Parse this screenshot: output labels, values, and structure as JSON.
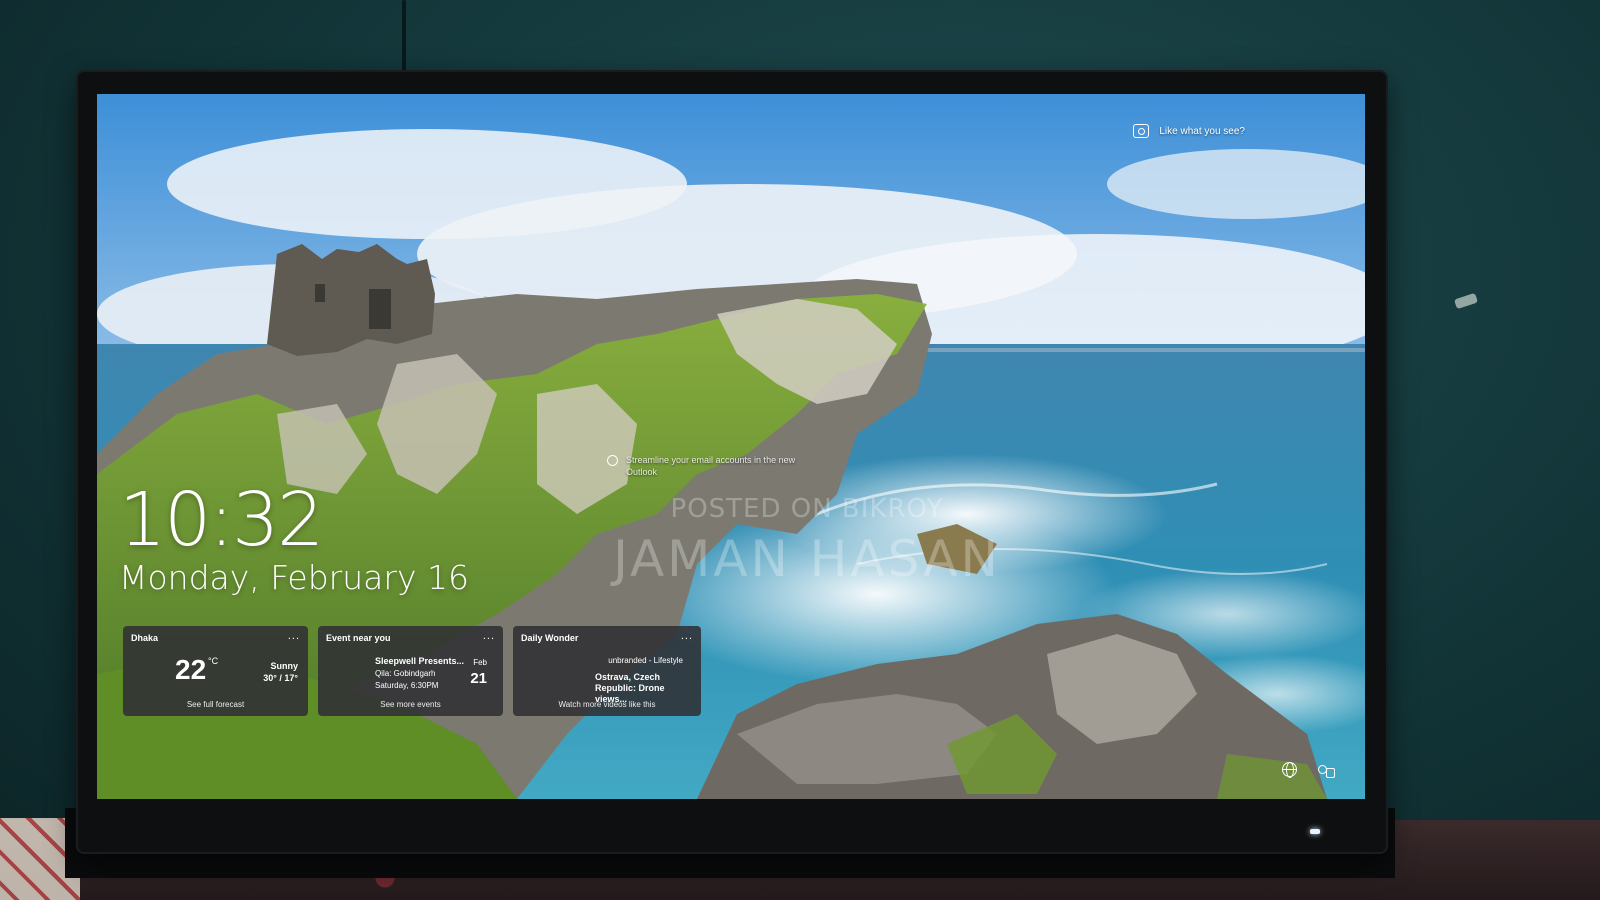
{
  "spotlight": {
    "label": "Like what you see?",
    "icon": "camera-icon"
  },
  "tip": {
    "text": "Streamline your email accounts in the new Outlook",
    "icon": "tip-icon"
  },
  "watermark": {
    "line1": "POSTED ON BIKROY",
    "line2": "JAMAN HASAN"
  },
  "clock": {
    "time": "10:32",
    "date": "Monday, February 16"
  },
  "widgets": {
    "weather": {
      "title": "Dhaka",
      "menu": "...",
      "temp": "22",
      "unit": "°C",
      "condition": "Sunny",
      "range": "30° / 17°",
      "footer": "See full forecast"
    },
    "event": {
      "title": "Event near you",
      "menu": "...",
      "name": "Sleepwell Presents...",
      "place": "Qila: Gobindgarh",
      "time": "Saturday, 6:30PM",
      "month": "Feb",
      "day": "21",
      "footer": "See more events"
    },
    "wonder": {
      "title": "Daily Wonder",
      "menu": "...",
      "source": "unbranded - Lifestyle",
      "headline": "Ostrava, Czech Republic: Drone views...",
      "footer": "Watch more videos like this"
    }
  },
  "system": {
    "network_icon": "globe-icon",
    "accessibility_icon": "accessibility-icon"
  },
  "colors": {
    "widget_bg": "#303034",
    "sea": "#2f8fb5",
    "sky": "#3a8fd6",
    "grass": "#6f9a2e"
  }
}
